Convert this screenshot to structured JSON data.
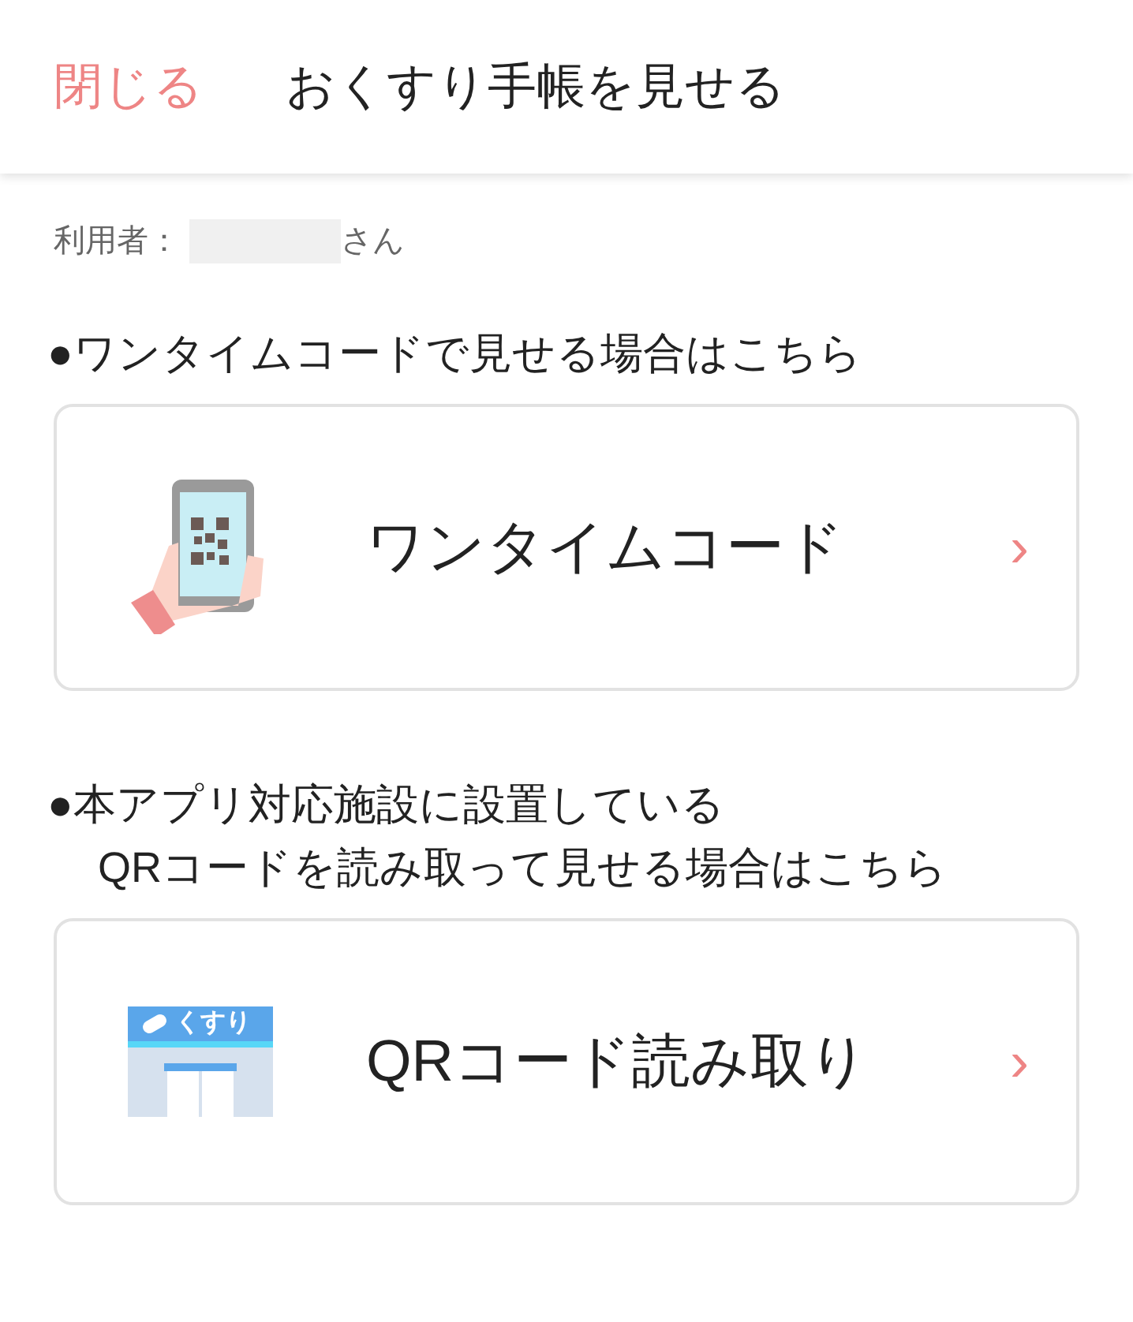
{
  "header": {
    "close": "閉じる",
    "title": "おくすり手帳を見せる"
  },
  "user": {
    "label": "利用者：",
    "suffix": "さん"
  },
  "sections": [
    {
      "kind": "phone",
      "heading": [
        "●ワンタイムコードで見せる場合はこちら"
      ],
      "card": {
        "label": "ワンタイムコード",
        "chevron": "›"
      }
    },
    {
      "kind": "store",
      "heading": [
        "●本アプリ対応施設に設置している",
        "QRコードを読み取って見せる場合はこちら"
      ],
      "card": {
        "label": "QRコード読み取り",
        "chevron": "›",
        "sign": "くすり"
      }
    }
  ]
}
